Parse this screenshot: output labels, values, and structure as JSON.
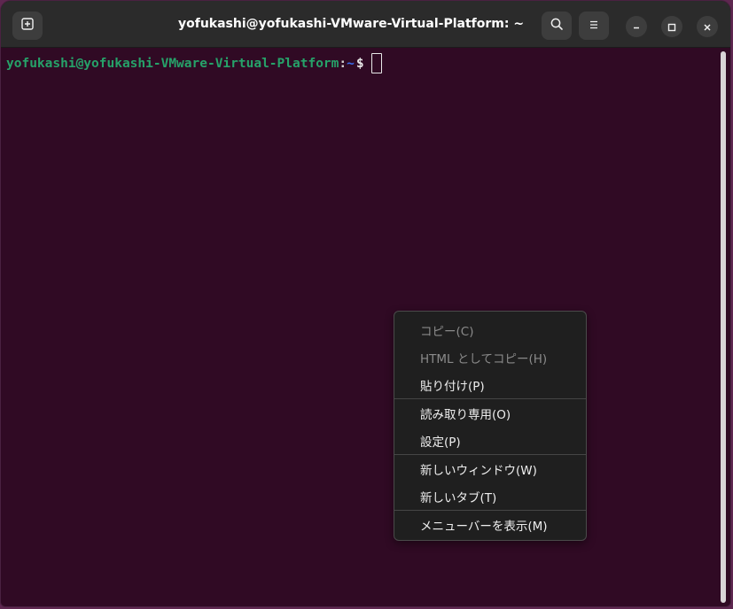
{
  "window": {
    "title": "yofukashi@yofukashi-VMware-Virtual-Platform: ~"
  },
  "icons": {
    "new_tab": "new-tab-icon",
    "search": "search-icon",
    "menu": "hamburger-menu-icon",
    "minimize": "minimize-icon",
    "maximize": "maximize-icon",
    "close": "close-icon"
  },
  "terminal": {
    "user_host": "yofukashi@yofukashi-VMware-Virtual-Platform",
    "separator": ":",
    "cwd": "~",
    "prompt_symbol": "$"
  },
  "context_menu": {
    "items": [
      {
        "label": "コピー(C)",
        "enabled": false
      },
      {
        "label": "HTML としてコピー(H)",
        "enabled": false
      },
      {
        "label": "貼り付け(P)",
        "enabled": true
      },
      {
        "label": "読み取り専用(O)",
        "enabled": true
      },
      {
        "label": "設定(P)",
        "enabled": true
      },
      {
        "label": "新しいウィンドウ(W)",
        "enabled": true
      },
      {
        "label": "新しいタブ(T)",
        "enabled": true
      },
      {
        "label": "メニューバーを表示(M)",
        "enabled": true
      }
    ]
  },
  "colors": {
    "terminal_bg": "#300a24",
    "user_host": "#26a269",
    "cwd": "#3a6ef0",
    "titlebar": "#2b2b2b",
    "menu_bg": "#1f1f1f"
  }
}
